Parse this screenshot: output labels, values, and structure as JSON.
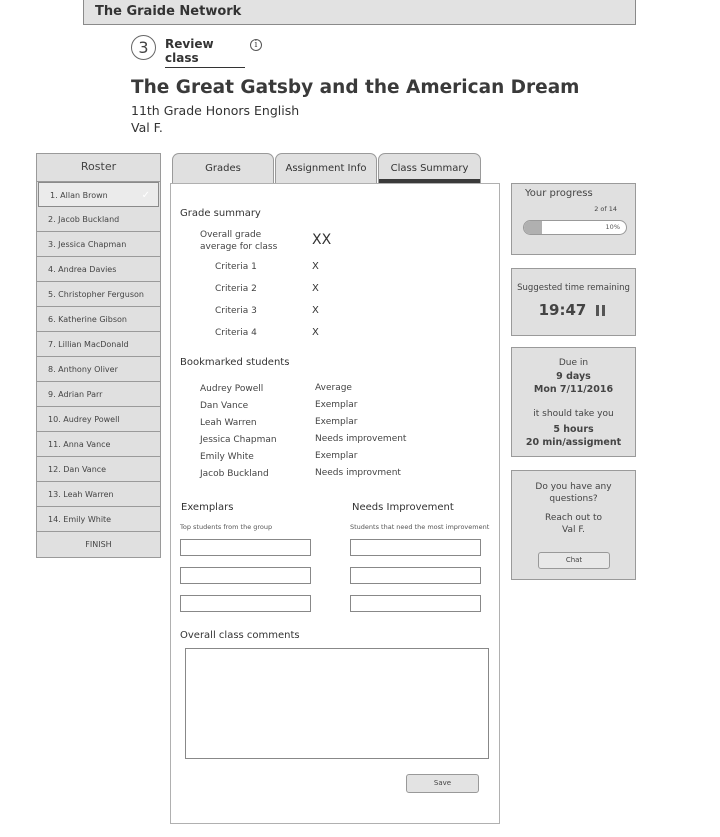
{
  "header": {
    "app_title": "The Graide Network"
  },
  "step": {
    "number": "3",
    "label": "Review class"
  },
  "page": {
    "title": "The Great Gatsby and the American Dream",
    "subtitle": "11th Grade Honors English",
    "teacher": "Val F."
  },
  "roster": {
    "title": "Roster",
    "items": [
      {
        "label": "1.  Allan Brown"
      },
      {
        "label": "2.  Jacob Buckland"
      },
      {
        "label": "3.  Jessica Chapman"
      },
      {
        "label": "4.  Andrea Davies"
      },
      {
        "label": "5.  Christopher Ferguson"
      },
      {
        "label": "6.  Katherine  Gibson"
      },
      {
        "label": "7.  Lillian MacDonald"
      },
      {
        "label": "8.  Anthony Oliver"
      },
      {
        "label": "9.  Adrian Parr"
      },
      {
        "label": "10. Audrey Powell"
      },
      {
        "label": "11. Anna Vance"
      },
      {
        "label": "12. Dan Vance"
      },
      {
        "label": "13. Leah Warren"
      },
      {
        "label": "14. Emily White"
      }
    ],
    "active_check": "✓",
    "finish_label": "FINISH"
  },
  "tabs": [
    {
      "label": "Grades"
    },
    {
      "label": "Assignment Info"
    },
    {
      "label": "Class Summary"
    }
  ],
  "grade_summary": {
    "title": "Grade summary",
    "overall_label_1": "Overall grade",
    "overall_label_2": "average for class",
    "overall_value": "XX",
    "criteria": [
      {
        "label": "Criteria 1",
        "value": "X"
      },
      {
        "label": "Criteria 2",
        "value": "X"
      },
      {
        "label": "Criteria 3",
        "value": "X"
      },
      {
        "label": "Criteria 4",
        "value": "X"
      }
    ]
  },
  "bookmarked": {
    "title": "Bookmarked students",
    "students": [
      {
        "name": "Audrey Powell",
        "status": "Average"
      },
      {
        "name": "Dan Vance",
        "status": "Exemplar"
      },
      {
        "name": "Leah Warren",
        "status": "Exemplar"
      },
      {
        "name": "Jessica Chapman",
        "status": "Needs improvement"
      },
      {
        "name": "Emily White",
        "status": "Exemplar"
      },
      {
        "name": "Jacob Buckland",
        "status": "Needs improvment"
      }
    ]
  },
  "exemplars": {
    "title": "Exemplars",
    "hint": "Top students from the group"
  },
  "needs_improvement": {
    "title": "Needs Improvement",
    "hint": "Students that need the most improvement"
  },
  "comments": {
    "title": "Overall class comments",
    "save_label": "Save"
  },
  "progress": {
    "title": "Your progress",
    "count": "2 of 14",
    "percent_label": "10%",
    "fraction": 0.1
  },
  "time": {
    "label": "Suggested time remaining",
    "value": "19:47"
  },
  "due": {
    "label": "Due in",
    "days": "9 days",
    "date": "Mon 7/11/2016",
    "should_take": "it should take you",
    "hours": "5 hours",
    "per_assignment": "20 min/assigment"
  },
  "help": {
    "line1": "Do you have any",
    "line2": "questions?",
    "reach1": "Reach out to",
    "reach2": "Val F.",
    "chat_label": "Chat"
  }
}
